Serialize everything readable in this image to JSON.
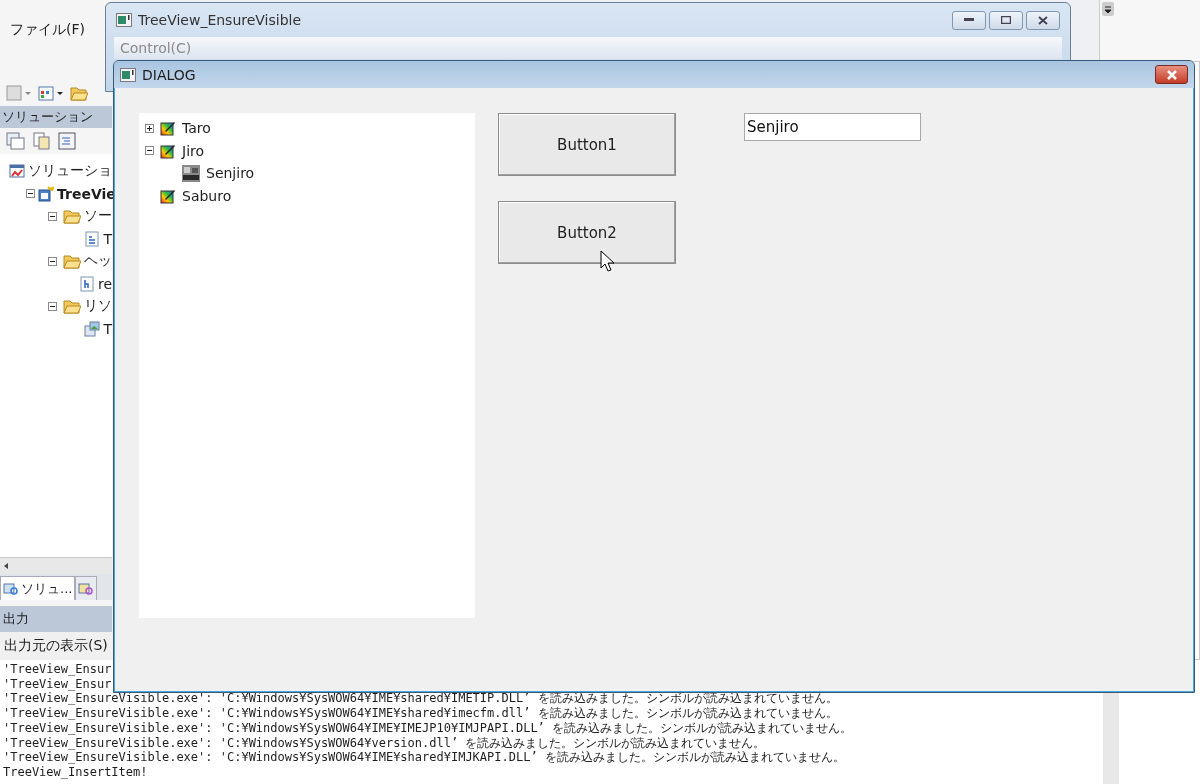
{
  "ide": {
    "menu": [
      {
        "label": "ファイル(F)"
      }
    ],
    "solution_explorer": {
      "title": "ソリューション",
      "tree": [
        {
          "label": "ソリューショ",
          "kind": "solution",
          "children": [
            {
              "label": "TreeVie",
              "kind": "project",
              "expanded": true,
              "children": [
                {
                  "label": "ソー",
                  "kind": "folder",
                  "expanded": true,
                  "children": [
                    {
                      "label": "T",
                      "kind": "cpp"
                    }
                  ]
                },
                {
                  "label": "ヘッ",
                  "kind": "folder",
                  "expanded": true,
                  "children": [
                    {
                      "label": "re",
                      "kind": "header"
                    }
                  ]
                },
                {
                  "label": "リソ",
                  "kind": "folder",
                  "expanded": true,
                  "children": [
                    {
                      "label": "T",
                      "kind": "resource"
                    }
                  ]
                }
              ]
            }
          ]
        }
      ]
    },
    "tabs": [
      {
        "label": "ソリュ...",
        "selected": true
      },
      {
        "selected": false
      }
    ],
    "output": {
      "title": "出力",
      "source_label": "出力元の表示(S)",
      "lines": [
        "'TreeView_Ensur",
        "'TreeView_Ensur",
        "'TreeView_EnsureVisible.exe': 'C:¥Windows¥SysWOW64¥IME¥shared¥IMETIP.DLL’ を読み込みました。シンボルが読み込まれていません。",
        "'TreeView_EnsureVisible.exe': 'C:¥Windows¥SysWOW64¥IME¥shared¥imecfm.dll’ を読み込みました。シンボルが読み込まれていません。",
        "'TreeView_EnsureVisible.exe': 'C:¥Windows¥SysWOW64¥IME¥IMEJP10¥IMJPAPI.DLL’ を読み込みました。シンボルが読み込まれていません。",
        "'TreeView_EnsureVisible.exe': 'C:¥Windows¥SysWOW64¥version.dll’ を読み込みました。シンボルが読み込まれていません。",
        "'TreeView_EnsureVisible.exe': 'C:¥Windows¥SysWOW64¥IME¥shared¥IMJKAPI.DLL’ を読み込みました。シンボルが読み込まれていません。",
        "TreeView_InsertItem!"
      ]
    }
  },
  "main_window": {
    "title": "TreeView_EnsureVisible",
    "menu": [
      {
        "label": "Control(C)",
        "disabled": true
      }
    ]
  },
  "dialog": {
    "title": "DIALOG",
    "tree": [
      {
        "label": "Taro",
        "kind": "paint",
        "expanded": false
      },
      {
        "label": "Jiro",
        "kind": "paint",
        "expanded": true,
        "children": [
          {
            "label": "Senjiro",
            "kind": "photo"
          }
        ]
      },
      {
        "label": "Saburo",
        "kind": "paint"
      }
    ],
    "buttons": [
      {
        "label": "Button1"
      },
      {
        "label": "Button2"
      }
    ],
    "edit": {
      "value": "Senjiro"
    }
  }
}
